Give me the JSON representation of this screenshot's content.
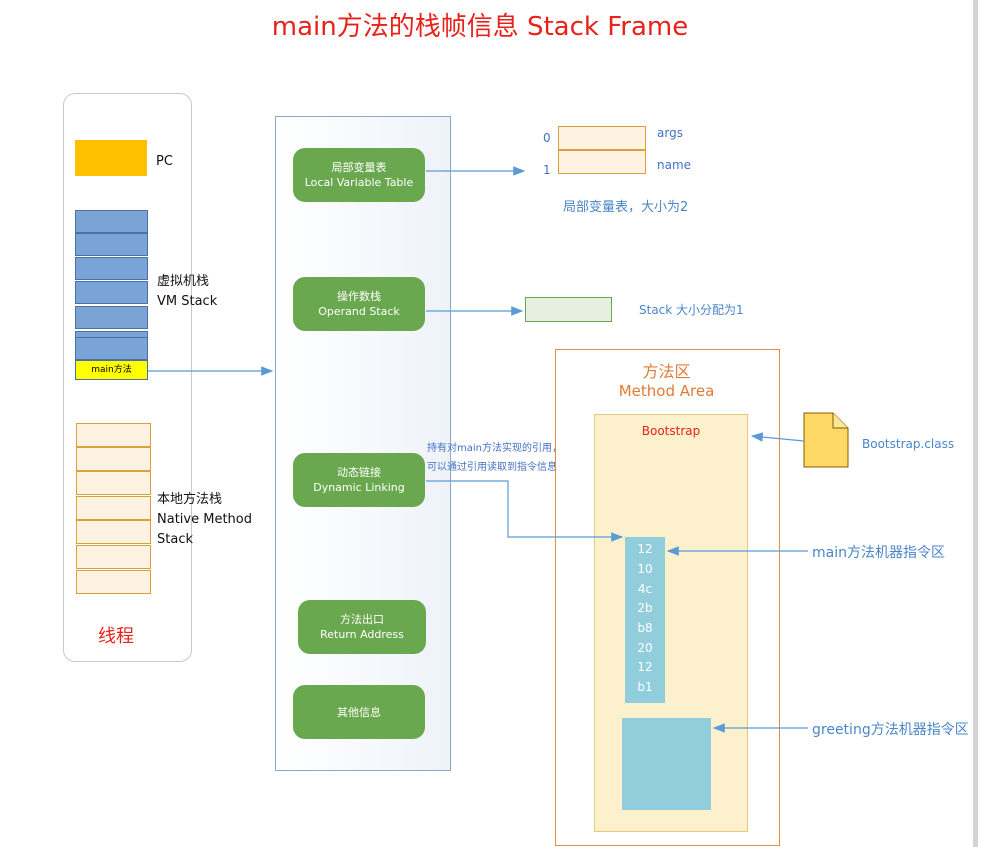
{
  "title": "main方法的栈帧信息  Stack Frame",
  "thread": {
    "pc_label": "PC",
    "vm_stack_label_cn": "虚拟机栈",
    "vm_stack_label_en": "VM Stack",
    "main_frame_label": "main方法",
    "native_stack_label_line1": "本地方法栈",
    "native_stack_label_line2": "Native Method",
    "native_stack_label_line3": "Stack",
    "thread_label": "线程"
  },
  "frame": {
    "items": [
      {
        "cn": "局部变量表",
        "en": "Local Variable Table"
      },
      {
        "cn": "操作数栈",
        "en": "Operand Stack"
      },
      {
        "cn": "动态链接",
        "en": "Dynamic Linking"
      },
      {
        "cn": "方法出口",
        "en": "Return Address"
      },
      {
        "cn": "其他信息",
        "en": ""
      }
    ]
  },
  "local_vars": {
    "slots": [
      {
        "index": "0",
        "name": "args"
      },
      {
        "index": "1",
        "name": "name"
      }
    ],
    "caption": "局部变量表，大小为2"
  },
  "operand_stack": {
    "caption": "Stack 大小分配为1"
  },
  "dynamic_link_note": {
    "line1": "持有对main方法实现的引用，",
    "line2": "可以通过引用读取到指令信息"
  },
  "method_area": {
    "title_cn": "方法区",
    "title_en": "Method Area",
    "bootstrap_label": "Bootstrap",
    "class_file_label": "Bootstrap.class",
    "main_instructions": [
      "12",
      "10",
      "4c",
      "2b",
      "b8",
      "20",
      "12",
      "b1"
    ],
    "main_instr_label": "main方法机器指令区",
    "greeting_instr_label": "greeting方法机器指令区"
  },
  "colors": {
    "title_red": "#e8221b",
    "pill_green": "#6aa84f",
    "vm_blue": "#7aa4d6",
    "pc_orange": "#ffc000",
    "instr_cyan": "#92cddc",
    "method_area_orange": "#e78a3f",
    "arrow_blue": "#5b9bd5"
  }
}
